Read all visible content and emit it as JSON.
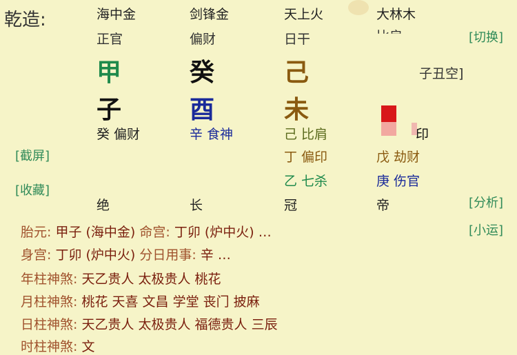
{
  "header": {
    "title": "乾造:"
  },
  "pillars": [
    {
      "nayin": "海中金",
      "shishen": "正官",
      "stem": "甲",
      "branch": "子",
      "hidden": "癸 偏财",
      "stage": "绝"
    },
    {
      "nayin": "剑锋金",
      "shishen": "偏财",
      "stem": "癸",
      "branch": "酉",
      "hidden": "辛 食神",
      "stage": "长"
    },
    {
      "nayin": "天上火",
      "shishen": "日干",
      "stem": "己",
      "branch": "未",
      "hidden": [
        "己 比肩",
        "丁 偏印",
        "乙 七杀"
      ],
      "stage": "冠"
    },
    {
      "nayin": "大林木",
      "shishen": "比肩",
      "stem": "",
      "branch": "",
      "hidden": [
        "印",
        "戊 劫财",
        "庚 伤官"
      ],
      "stage": "帝"
    }
  ],
  "kongwang": "子丑空]",
  "buttons": {
    "switch": "[切换]",
    "screenshot": "[截屏]",
    "favorite": "[收藏]",
    "analysis": "[分析]",
    "xiaoyun": "[小运]"
  },
  "info": [
    {
      "label": "胎元:",
      "value": "甲子 (海中金)",
      "label2": "命宫:",
      "value2": "丁卯 (炉中火) …"
    },
    {
      "label": "身宫:",
      "value": "丁卯 (炉中火)",
      "label2": "分日用事:",
      "value2": "辛 …"
    },
    {
      "label": "年柱神煞:",
      "value": "天乙贵人 太极贵人 桃花"
    },
    {
      "label": "月柱神煞:",
      "value": "桃花 天喜 文昌 学堂 丧门 披麻"
    },
    {
      "label": "日柱神煞:",
      "value": "天乙贵人 太极贵人 福德贵人 三辰"
    },
    {
      "label": "时柱神煞:",
      "value": "文"
    }
  ],
  "colors": {
    "background": "#f6f4c8",
    "wood": "#1f8a4c",
    "water": "#111111",
    "metal": "#1a2a9a",
    "earth": "#8a5a10"
  }
}
